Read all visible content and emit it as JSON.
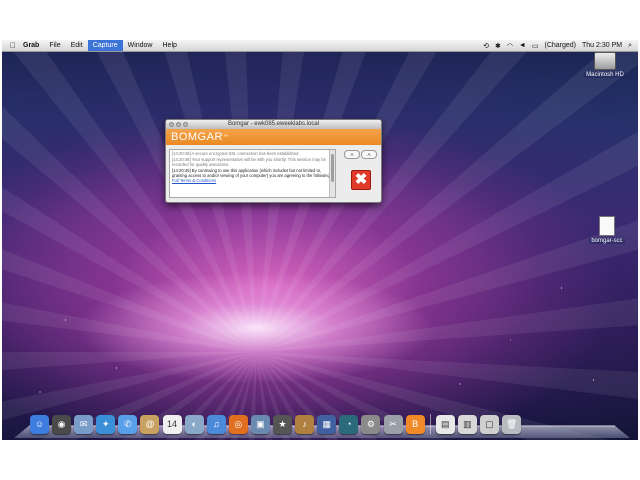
{
  "menubar": {
    "items": [
      "Grab",
      "File",
      "Edit",
      "Capture",
      "Window",
      "Help"
    ],
    "active_item": "Capture",
    "battery_status": "(Charged)",
    "clock": "Thu 2:30 PM"
  },
  "desktop": {
    "icons": [
      {
        "label": "Macintosh HD",
        "icon": "hard-drive-icon"
      },
      {
        "label": "bomgar-scc",
        "icon": "disk-image-icon"
      }
    ]
  },
  "bomgar_window": {
    "title": "Bomgar - ewk085.eweeklabs.local",
    "brand": "BOMGAR",
    "trademark": "™",
    "messages": [
      "[14:20:48]  A secure encrypted SSL connection has been established",
      "[14:20:48]  Your support representative will be with you shortly. This session may be recorded for quality assurance.",
      "[14:20:49]  By continuing to use this application (which includes but not limited to, granting access to and/or viewing of your computer) you are agreeing to the following."
    ],
    "terms_link": "Full Terms & Conditions",
    "font_buttons": [
      "A",
      "A"
    ],
    "close_icon": "red-x-icon"
  },
  "dock": {
    "icons": [
      {
        "name": "finder-icon",
        "color": "#3d7de0",
        "glyph": "☺"
      },
      {
        "name": "dashboard-icon",
        "color": "#4a4a4a",
        "glyph": "◉"
      },
      {
        "name": "mail-stamp-icon",
        "color": "#7a9cc8",
        "glyph": "✉"
      },
      {
        "name": "safari-icon",
        "color": "#3a8fd8",
        "glyph": "✦"
      },
      {
        "name": "ichat-icon",
        "color": "#5aa0e8",
        "glyph": "✆"
      },
      {
        "name": "address-book-icon",
        "color": "#c8a060",
        "glyph": "@"
      },
      {
        "name": "ical-icon",
        "color": "#f0f0f0",
        "glyph": "14"
      },
      {
        "name": "preview-icon",
        "color": "#8aa8c8",
        "glyph": "◐"
      },
      {
        "name": "itunes-icon",
        "color": "#4a8ad8",
        "glyph": "♫"
      },
      {
        "name": "firefox-icon",
        "color": "#e07020",
        "glyph": "◎"
      },
      {
        "name": "iphoto-icon",
        "color": "#6a8ab0",
        "glyph": "▣"
      },
      {
        "name": "imovie-icon",
        "color": "#555555",
        "glyph": "★"
      },
      {
        "name": "garageband-icon",
        "color": "#b08040",
        "glyph": "♪"
      },
      {
        "name": "spaces-icon",
        "color": "#4060a0",
        "glyph": "▦"
      },
      {
        "name": "time-machine-icon",
        "color": "#2a6a7a",
        "glyph": "◔"
      },
      {
        "name": "system-preferences-icon",
        "color": "#8a8a8a",
        "glyph": "⚙"
      },
      {
        "name": "grab-icon",
        "color": "#9aa0a8",
        "glyph": "✂"
      },
      {
        "name": "bomgar-icon",
        "color": "#f08a28",
        "glyph": "B"
      },
      {
        "name": "documents-stack-icon",
        "color": "#e8e8e8",
        "glyph": "▤"
      },
      {
        "name": "downloads-stack-icon",
        "color": "#d8d8d8",
        "glyph": "▥"
      },
      {
        "name": "applications-stack-icon",
        "color": "#cfcfcf",
        "glyph": "▢"
      },
      {
        "name": "trash-icon",
        "color": "#b8bcc0",
        "glyph": "🗑"
      }
    ]
  }
}
